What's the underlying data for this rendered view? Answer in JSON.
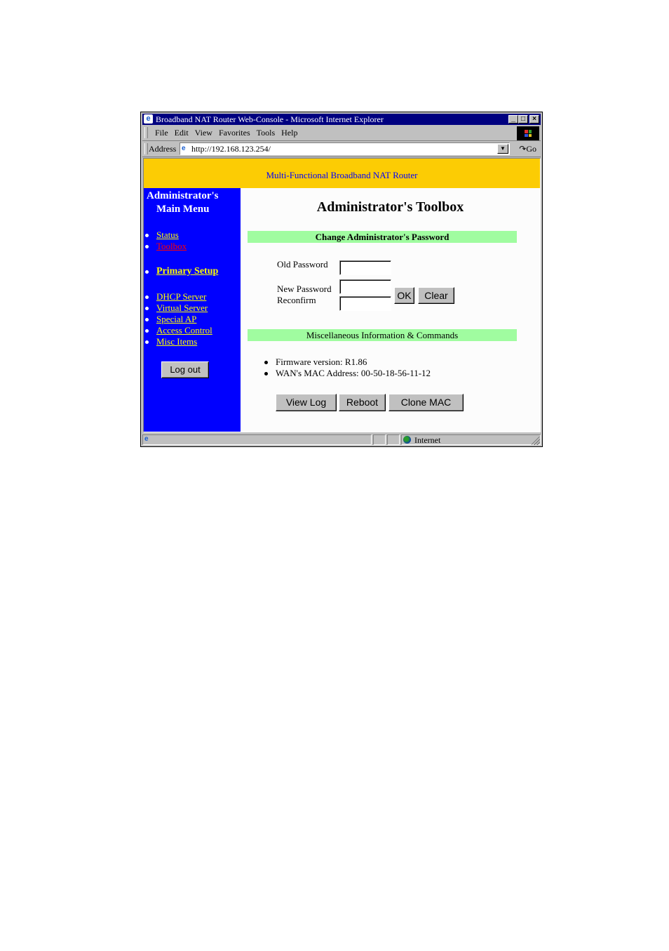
{
  "window": {
    "title": "Broadband NAT Router Web-Console - Microsoft Internet Explorer",
    "controls": {
      "minimize": "_",
      "maximize": "□",
      "close": "×"
    }
  },
  "menubar": {
    "items": [
      "File",
      "Edit",
      "View",
      "Favorites",
      "Tools",
      "Help"
    ]
  },
  "addressbar": {
    "label": "Address",
    "url": "http://192.168.123.254/",
    "dropdown_glyph": "▼",
    "go_label": "↷Go"
  },
  "banner": {
    "text": "Multi-Functional Broadband NAT Router",
    "bg_color": "#fccc04",
    "text_color": "#0000ff"
  },
  "sidebar": {
    "title_line1": "Administrator's",
    "title_line2": "Main Menu",
    "bg_color": "#0000ff",
    "group1": [
      {
        "label": "Status",
        "active": false
      },
      {
        "label": "Toolbox",
        "active": true
      }
    ],
    "group2": [
      {
        "label": "Primary Setup",
        "active": false
      }
    ],
    "group3": [
      {
        "label": "DHCP Server",
        "active": false
      },
      {
        "label": "Virtual Server",
        "active": false
      },
      {
        "label": "Special AP",
        "active": false
      },
      {
        "label": "Access Control",
        "active": false
      },
      {
        "label": "Misc Items",
        "active": false
      }
    ],
    "logout_label": "Log out"
  },
  "main": {
    "heading": "Administrator's Toolbox",
    "password_section": {
      "title": "Change Administrator's Password",
      "old_password_label": "Old Password",
      "old_password_value": "",
      "new_password_label": "New Password",
      "new_password_value": "",
      "reconfirm_label": "Reconfirm",
      "reconfirm_value": "",
      "ok_label": "OK",
      "clear_label": "Clear"
    },
    "misc_section": {
      "title": "Miscellaneous Information & Commands",
      "info": [
        "Firmware version: R1.86",
        "WAN's MAC Address: 00-50-18-56-11-12"
      ],
      "buttons": {
        "view_log": "View Log",
        "reboot": "Reboot",
        "clone_mac": "Clone MAC"
      }
    },
    "section_color": "#a0fca0"
  },
  "statusbar": {
    "status_text": "",
    "zone": "Internet"
  }
}
